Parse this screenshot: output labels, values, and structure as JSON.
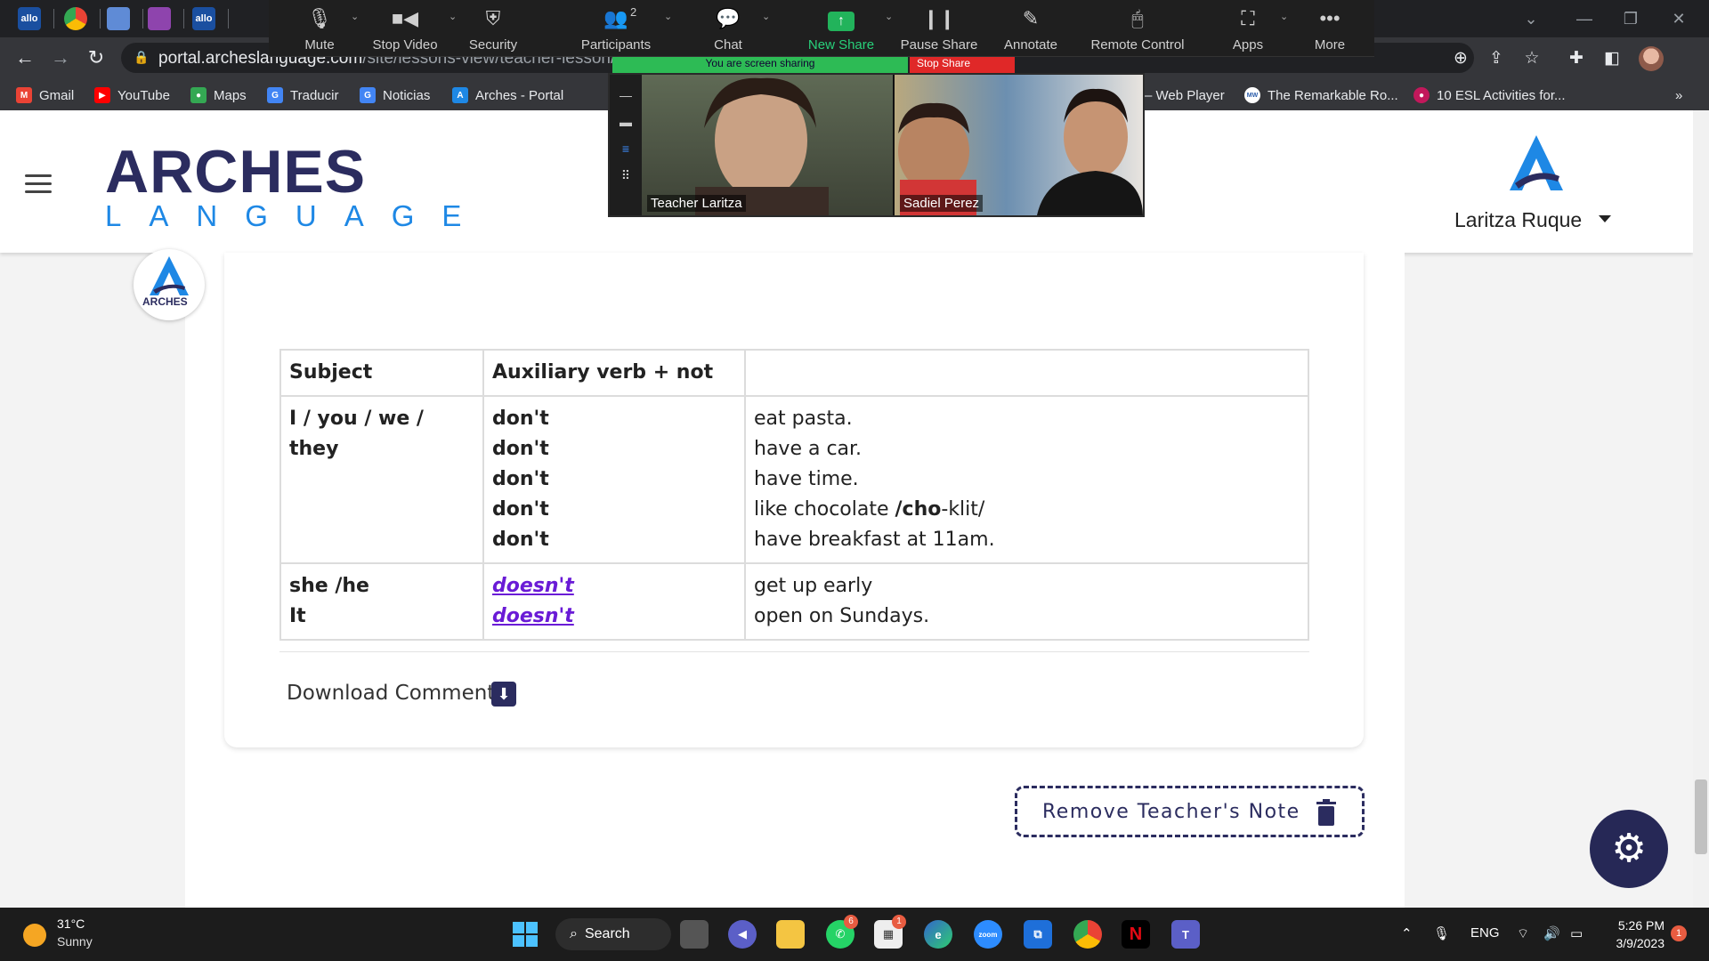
{
  "browser": {
    "url_host": "portal.archeslanguage.com",
    "url_path": "/site/lessons-view/teacher-lesson/guid",
    "bookmarks": [
      {
        "label": "Gmail",
        "color": "#ea4335",
        "glyph": "M"
      },
      {
        "label": "YouTube",
        "color": "#ff0000",
        "glyph": "▶"
      },
      {
        "label": "Maps",
        "color": "#34a853",
        "glyph": "●"
      },
      {
        "label": "Traducir",
        "color": "#4285f4",
        "glyph": "G"
      },
      {
        "label": "Noticias",
        "color": "#4285f4",
        "glyph": "G"
      },
      {
        "label": "Arches - Portal",
        "color": "#1e88e5",
        "glyph": "A"
      },
      {
        "label": "– Web Player",
        "color": "#35363a",
        "glyph": ""
      },
      {
        "label": "The Remarkable Ro...",
        "color": "#ffffff",
        "glyph": "MW"
      },
      {
        "label": "10 ESL Activities for...",
        "color": "#c2185b",
        "glyph": "●"
      }
    ]
  },
  "zoom": {
    "buttons": [
      {
        "label": "Mute",
        "icon": "microphone-icon"
      },
      {
        "label": "Stop Video",
        "icon": "video-camera-icon"
      },
      {
        "label": "Security",
        "icon": "shield-icon"
      },
      {
        "label": "Participants",
        "icon": "participants-icon",
        "count": "2"
      },
      {
        "label": "Chat",
        "icon": "chat-icon"
      },
      {
        "label": "New Share",
        "icon": "share-arrow-icon"
      },
      {
        "label": "Pause Share",
        "icon": "pause-icon"
      },
      {
        "label": "Annotate",
        "icon": "pencil-icon"
      },
      {
        "label": "Remote Control",
        "icon": "mouse-icon"
      },
      {
        "label": "Apps",
        "icon": "apps-icon"
      },
      {
        "label": "More",
        "icon": "ellipsis-icon"
      }
    ],
    "sharing_banner": "You are screen sharing",
    "stop_share": "Stop Share",
    "participants": [
      {
        "name": "Teacher Laritza"
      },
      {
        "name": "Sadiel Perez"
      }
    ]
  },
  "header": {
    "logo_main": "ARCHES",
    "logo_sub": "LANGUAGE",
    "user_name": "Laritza Ruque"
  },
  "badge": {
    "text": "ARCHES"
  },
  "table": {
    "headers": [
      "Subject",
      "Auxiliary verb + not",
      ""
    ],
    "rows": [
      {
        "subject": [
          "I / you / we / they"
        ],
        "aux": [
          "don't",
          "don't",
          "don't",
          "don't",
          "don't"
        ],
        "completions": [
          "eat pasta.",
          "have a car.",
          "have time.",
          "like chocolate ",
          "have breakfast at 11am."
        ],
        "pron_bold": "/cho",
        "pron_rest": "-klit/"
      },
      {
        "subject": [
          "she /he",
          "It"
        ],
        "aux": [
          "doesn't",
          "doesn't"
        ],
        "completions": [
          "get up early",
          "open on Sundays."
        ]
      }
    ]
  },
  "download_comment": "Download Comment",
  "remove_note": "Remove Teacher's Note",
  "taskbar": {
    "temp": "31°C",
    "weather": "Sunny",
    "search": "Search",
    "lang": "ENG",
    "time": "5:26 PM",
    "date": "3/9/2023",
    "whatsapp_badge": "6",
    "store_badge": "1",
    "notifications": "1"
  }
}
